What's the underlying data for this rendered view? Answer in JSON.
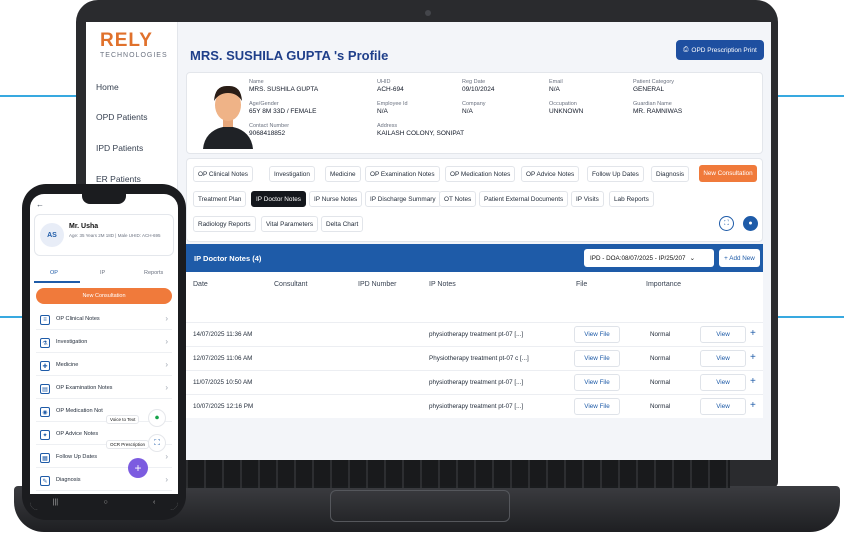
{
  "colors": {
    "primary": "#1e5ba8",
    "accent": "#f07a3b",
    "active_tab": "#14171c",
    "decor": "#38a9e0"
  },
  "logo": {
    "text_main": "RELY",
    "text_sub": "TECHNOLOGIES"
  },
  "sidebar": {
    "items": [
      {
        "label": "Home"
      },
      {
        "label": "OPD Patients"
      },
      {
        "label": "IPD Patients"
      },
      {
        "label": "ER Patients"
      }
    ]
  },
  "header": {
    "title": "MRS. SUSHILA GUPTA 's Profile",
    "print_button": "OPD Prescription Print"
  },
  "patient": {
    "name_label": "Name",
    "name": "MRS. SUSHILA GUPTA",
    "uhid_label": "UHID",
    "uhid": "ACH-694",
    "regdate_label": "Reg Date",
    "regdate": "09/10/2024",
    "email_label": "Email",
    "email": "N/A",
    "category_label": "Patient Category",
    "category": "GENERAL",
    "age_label": "Age/Gender",
    "age": "65Y 8M 33D / FEMALE",
    "employee_label": "Employee Id",
    "employee": "N/A",
    "company_label": "Company",
    "company": "N/A",
    "occupation_label": "Occupation",
    "occupation": "UNKNOWN",
    "guardian_label": "Guardian Name",
    "guardian": "MR. RAMNIWAS",
    "contact_label": "Contact Number",
    "contact": "9068418852",
    "address_label": "Address",
    "address": "KAILASH COLONY, SONIPAT"
  },
  "tabs": {
    "row1": [
      "OP Clinical Notes",
      "Investigation",
      "Medicine",
      "OP Examination Notes",
      "OP Medication Notes",
      "OP Advice Notes",
      "Follow Up Dates",
      "Diagnosis"
    ],
    "row2": [
      "Treatment Plan",
      "IP Doctor Notes",
      "IP Nurse Notes",
      "IP Discharge Summary",
      "OT Notes",
      "Patient External Documents",
      "IP Visits",
      "Lab Reports"
    ],
    "row3": [
      "Radiology Reports",
      "Vital Parameters",
      "Delta Chart"
    ],
    "new_consultation": "New Consultation"
  },
  "notes": {
    "title": "IP Doctor Notes (4)",
    "date_filter": "IPD - DOA:08/07/2025 - IP/25/207",
    "add_new": "+ Add New",
    "columns": [
      "Date",
      "Consultant",
      "IPD Number",
      "IP Notes",
      "File",
      "Importance"
    ],
    "rows": [
      {
        "date": "14/07/2025 11:36 AM",
        "note": "physiotherapy treatment pt-07 [...]",
        "file": "View File",
        "importance": "Normal",
        "view": "View"
      },
      {
        "date": "12/07/2025 11:06 AM",
        "note": "Physiotherapy treatment pt-07 c [...]",
        "file": "View File",
        "importance": "Normal",
        "view": "View"
      },
      {
        "date": "11/07/2025 10:50 AM",
        "note": "physiotherapy treatment pt-07 [...]",
        "file": "View File",
        "importance": "Normal",
        "view": "View"
      },
      {
        "date": "10/07/2025 12:16 PM",
        "note": "physiotherapy treatment pt-07 [...]",
        "file": "View File",
        "importance": "Normal",
        "view": "View"
      }
    ]
  },
  "phone": {
    "initials": "AS",
    "name": "Mr. Usha",
    "subtitle": "Age: 35 Years 2M 18D | Male UHID: ACH-695",
    "tabs": [
      "OP",
      "IP",
      "Reports"
    ],
    "new_consultation": "New Consultation",
    "items": [
      "OP Clinical Notes",
      "Investigation",
      "Medicine",
      "OP Examination Notes",
      "OP Medication Not",
      "OP Advice Notes",
      "Follow Up Dates",
      "Diagnosis"
    ],
    "fab_voice": "Voice to Text",
    "fab_ocr": "OCR Prescription"
  }
}
